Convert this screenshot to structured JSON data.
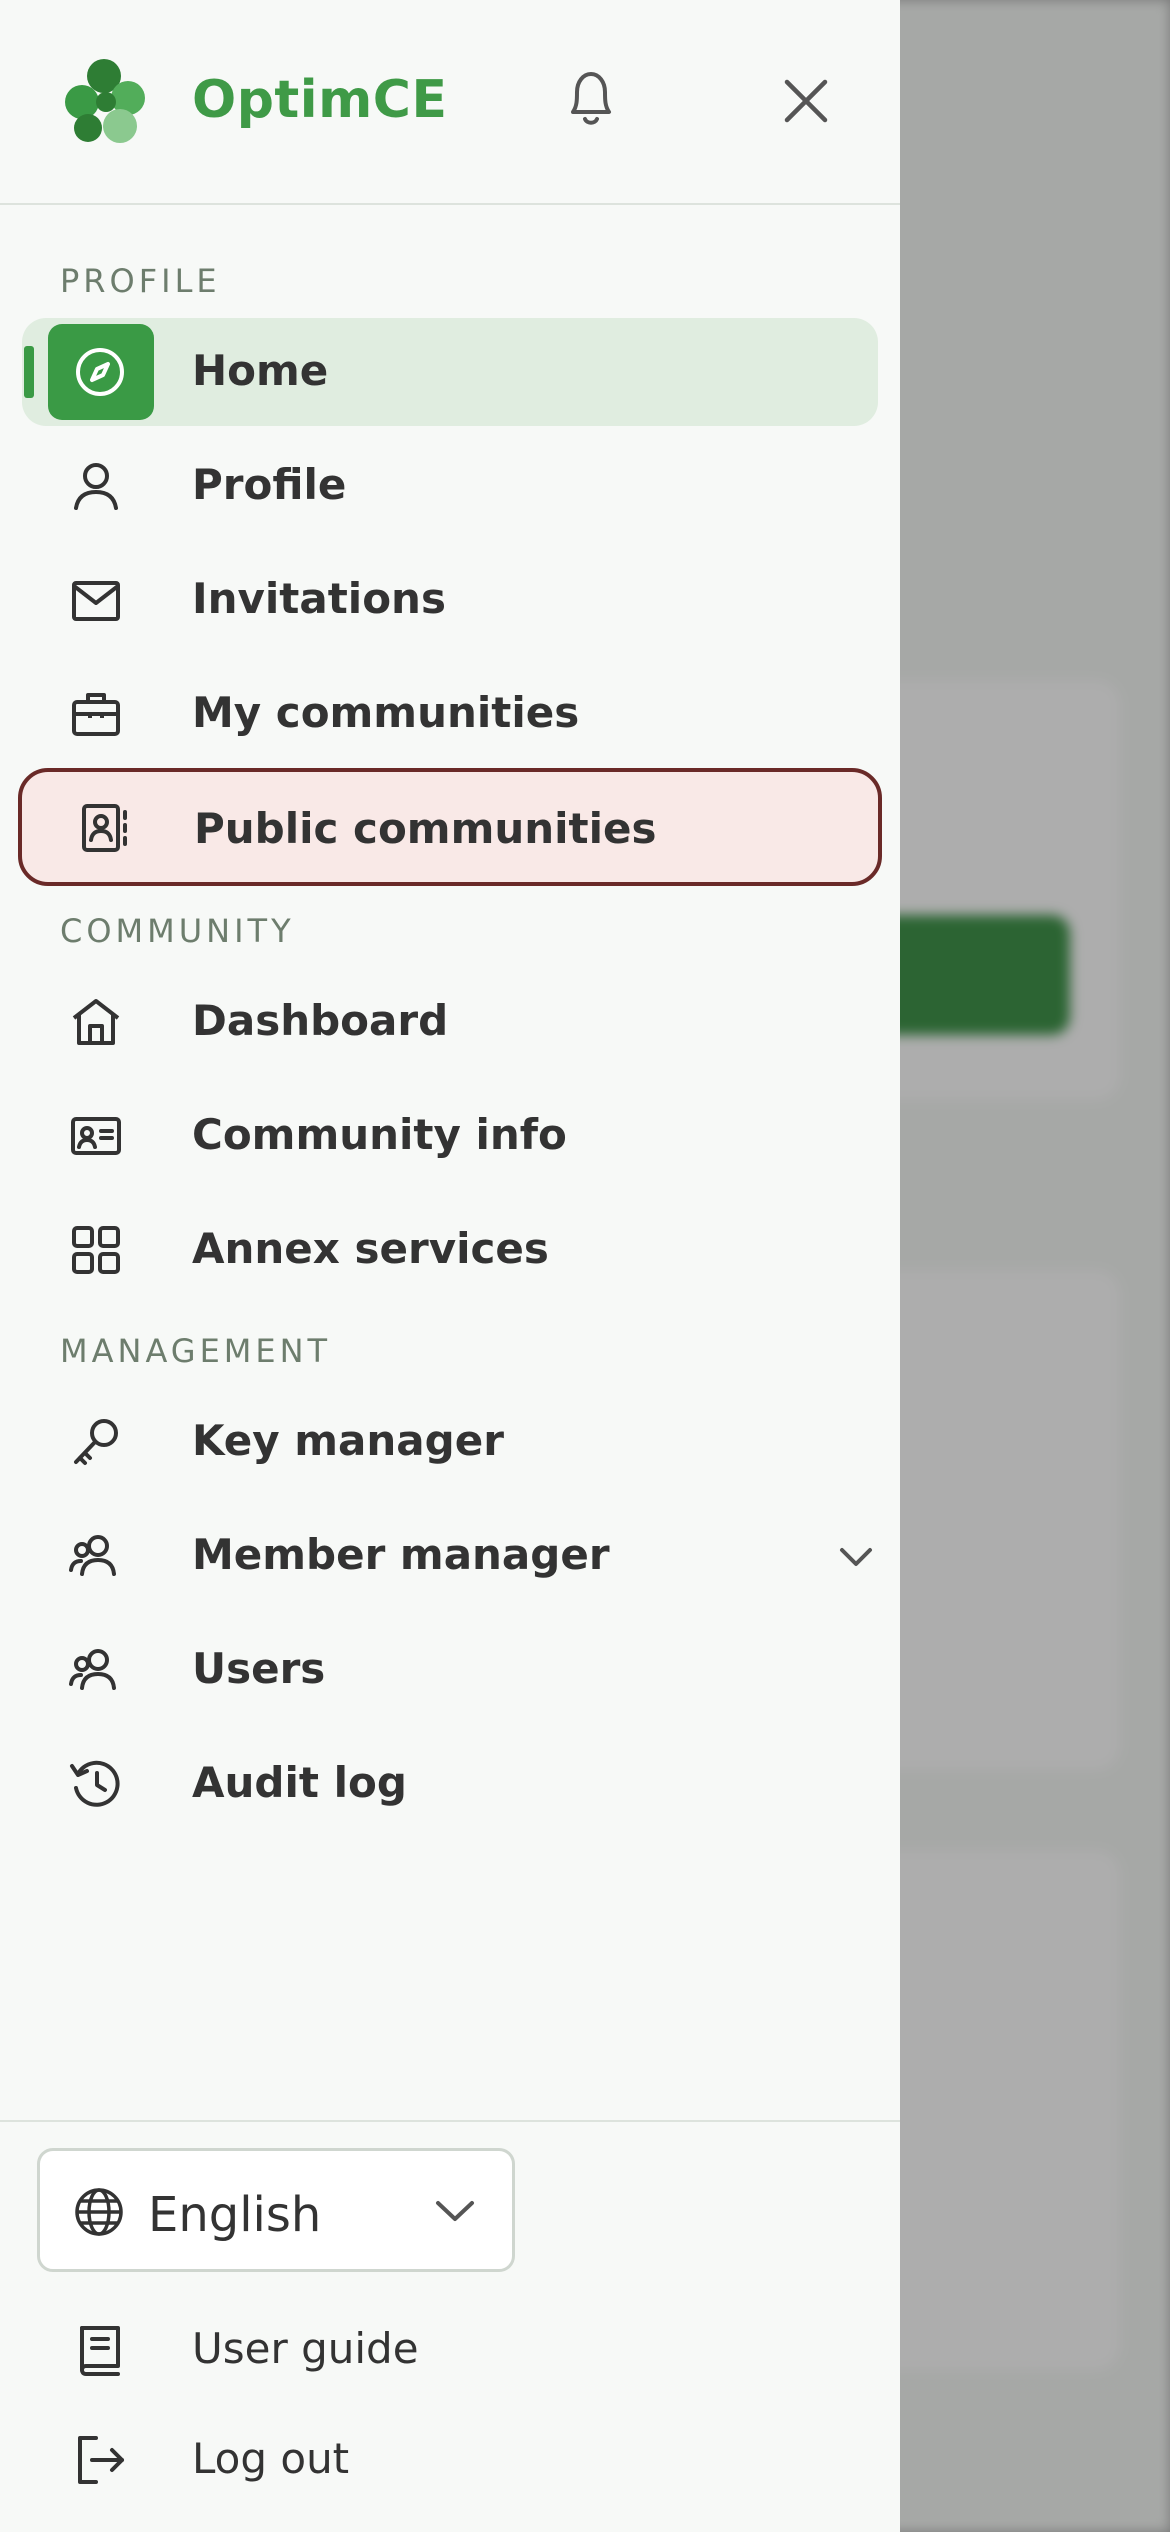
{
  "app": {
    "brand": "OptimCE"
  },
  "colors": {
    "brand_green": "#3a9a45",
    "highlight_border": "#6a2a28",
    "highlight_bg": "#f9e9e7",
    "active_bg": "#e0ede0"
  },
  "header": {
    "bell_icon": "bell-icon",
    "close_icon": "close-icon"
  },
  "sections": {
    "profile": "PROFILE",
    "community": "COMMUNITY",
    "management": "MANAGEMENT"
  },
  "nav": {
    "home": {
      "label": "Home",
      "icon": "compass-icon",
      "active": true
    },
    "profile": {
      "label": "Profile",
      "icon": "user-icon"
    },
    "invitations": {
      "label": "Invitations",
      "icon": "mail-icon"
    },
    "my_communities": {
      "label": "My communities",
      "icon": "briefcase-icon"
    },
    "public_communities": {
      "label": "Public communities",
      "icon": "contact-book-icon",
      "highlighted": true
    },
    "dashboard": {
      "label": "Dashboard",
      "icon": "home-icon"
    },
    "community_info": {
      "label": "Community info",
      "icon": "id-card-icon"
    },
    "annex_services": {
      "label": "Annex services",
      "icon": "grid-icon"
    },
    "key_manager": {
      "label": "Key manager",
      "icon": "key-icon"
    },
    "member_manager": {
      "label": "Member manager",
      "icon": "users-icon",
      "expandable": true
    },
    "users": {
      "label": "Users",
      "icon": "users-icon"
    },
    "audit_log": {
      "label": "Audit log",
      "icon": "history-icon"
    }
  },
  "footer": {
    "language": {
      "selected": "English",
      "icon": "globe-icon"
    },
    "user_guide": {
      "label": "User guide",
      "icon": "book-icon"
    },
    "logout": {
      "label": "Log out",
      "icon": "logout-icon"
    }
  }
}
